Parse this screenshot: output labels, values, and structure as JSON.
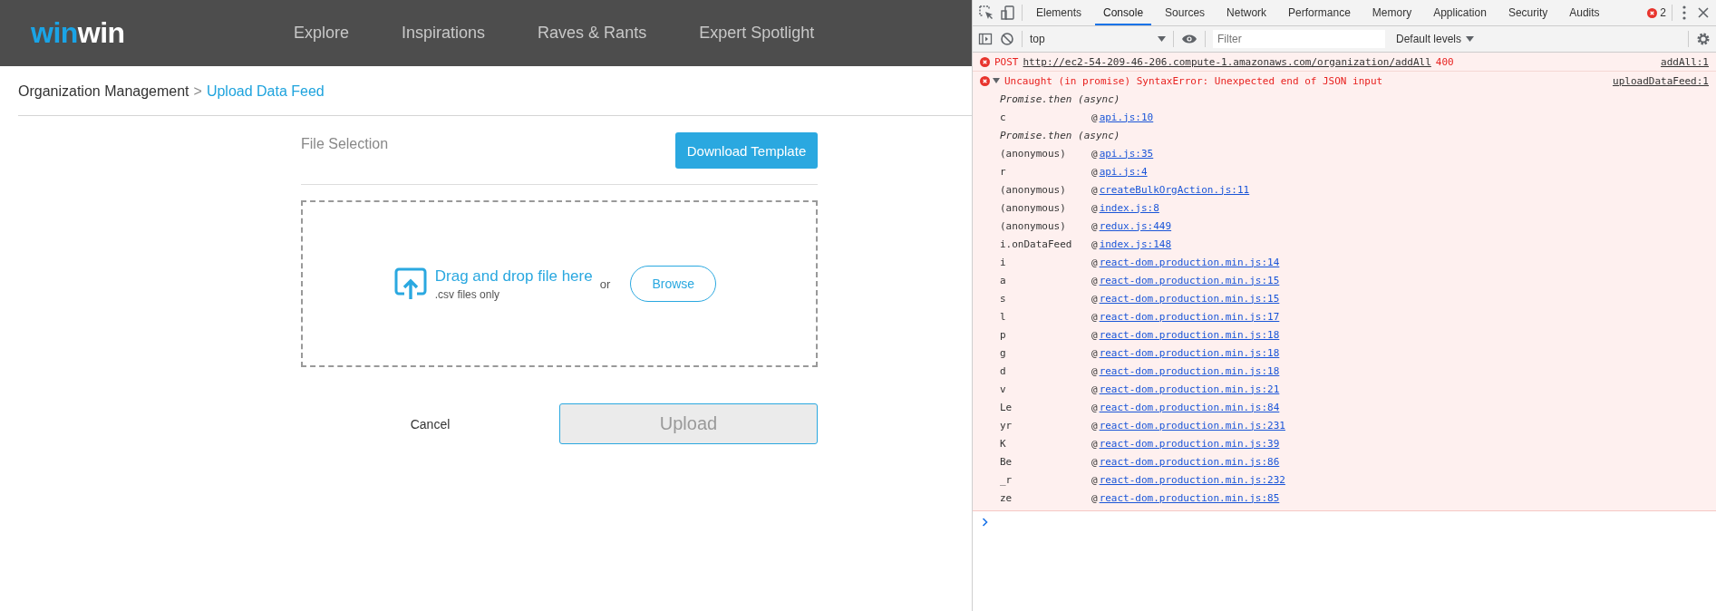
{
  "header": {
    "logo": [
      "win",
      "win"
    ],
    "nav": [
      "Explore",
      "Inspirations",
      "Raves & Rants",
      "Expert Spotlight"
    ]
  },
  "breadcrumb": {
    "items": [
      {
        "label": "Organization Management",
        "current": false
      },
      {
        "label": "Upload Data Feed",
        "current": true
      }
    ],
    "separator": ">"
  },
  "form": {
    "section_title": "File Selection",
    "download_button": "Download Template",
    "dropzone": {
      "title": "Drag and drop file here",
      "hint": ".csv files only",
      "or": "or",
      "browse_button": "Browse"
    },
    "cancel": "Cancel",
    "upload": {
      "label": "Upload",
      "disabled": true
    }
  },
  "devtools": {
    "tabs": [
      {
        "label": "Elements",
        "selected": false
      },
      {
        "label": "Console",
        "selected": true
      },
      {
        "label": "Sources",
        "selected": false
      },
      {
        "label": "Network",
        "selected": false
      },
      {
        "label": "Performance",
        "selected": false
      },
      {
        "label": "Memory",
        "selected": false
      },
      {
        "label": "Application",
        "selected": false
      },
      {
        "label": "Security",
        "selected": false
      },
      {
        "label": "Audits",
        "selected": false
      }
    ],
    "error_count": "2",
    "context": "top",
    "filter_placeholder": "Filter",
    "levels": "Default levels",
    "messages": [
      {
        "kind": "error",
        "method": "POST",
        "url": "http://ec2-54-209-46-206.compute-1.amazonaws.com/organization/addAll",
        "status": "400",
        "source": "addAll:1"
      },
      {
        "kind": "exception",
        "expanded": true,
        "message": "Uncaught (in promise) SyntaxError: Unexpected end of JSON input",
        "source": "uploadDataFeed:1"
      },
      {
        "kind": "async",
        "text": "Promise.then (async)"
      },
      {
        "kind": "frame",
        "fn": "c",
        "at": "@",
        "link": "api.js:10"
      },
      {
        "kind": "async",
        "text": "Promise.then (async)"
      },
      {
        "kind": "frame",
        "fn": "(anonymous)",
        "at": "@",
        "link": "api.js:35"
      },
      {
        "kind": "frame",
        "fn": "r",
        "at": "@",
        "link": "api.js:4"
      },
      {
        "kind": "frame",
        "fn": "(anonymous)",
        "at": "@",
        "link": "createBulkOrgAction.js:11"
      },
      {
        "kind": "frame",
        "fn": "(anonymous)",
        "at": "@",
        "link": "index.js:8"
      },
      {
        "kind": "frame",
        "fn": "(anonymous)",
        "at": "@",
        "link": "redux.js:449"
      },
      {
        "kind": "frame",
        "fn": "i.onDataFeed",
        "at": "@",
        "link": "index.js:148"
      },
      {
        "kind": "frame",
        "fn": "i",
        "at": "@",
        "link": "react-dom.production.min.js:14"
      },
      {
        "kind": "frame",
        "fn": "a",
        "at": "@",
        "link": "react-dom.production.min.js:15"
      },
      {
        "kind": "frame",
        "fn": "s",
        "at": "@",
        "link": "react-dom.production.min.js:15"
      },
      {
        "kind": "frame",
        "fn": "l",
        "at": "@",
        "link": "react-dom.production.min.js:17"
      },
      {
        "kind": "frame",
        "fn": "p",
        "at": "@",
        "link": "react-dom.production.min.js:18"
      },
      {
        "kind": "frame",
        "fn": "g",
        "at": "@",
        "link": "react-dom.production.min.js:18"
      },
      {
        "kind": "frame",
        "fn": "d",
        "at": "@",
        "link": "react-dom.production.min.js:18"
      },
      {
        "kind": "frame",
        "fn": "v",
        "at": "@",
        "link": "react-dom.production.min.js:21"
      },
      {
        "kind": "frame",
        "fn": "Le",
        "at": "@",
        "link": "react-dom.production.min.js:84"
      },
      {
        "kind": "frame",
        "fn": "yr",
        "at": "@",
        "link": "react-dom.production.min.js:231"
      },
      {
        "kind": "frame",
        "fn": "K",
        "at": "@",
        "link": "react-dom.production.min.js:39"
      },
      {
        "kind": "frame",
        "fn": "Be",
        "at": "@",
        "link": "react-dom.production.min.js:86"
      },
      {
        "kind": "frame",
        "fn": "_r",
        "at": "@",
        "link": "react-dom.production.min.js:232"
      },
      {
        "kind": "frame",
        "fn": "ze",
        "at": "@",
        "link": "react-dom.production.min.js:85"
      }
    ]
  }
}
